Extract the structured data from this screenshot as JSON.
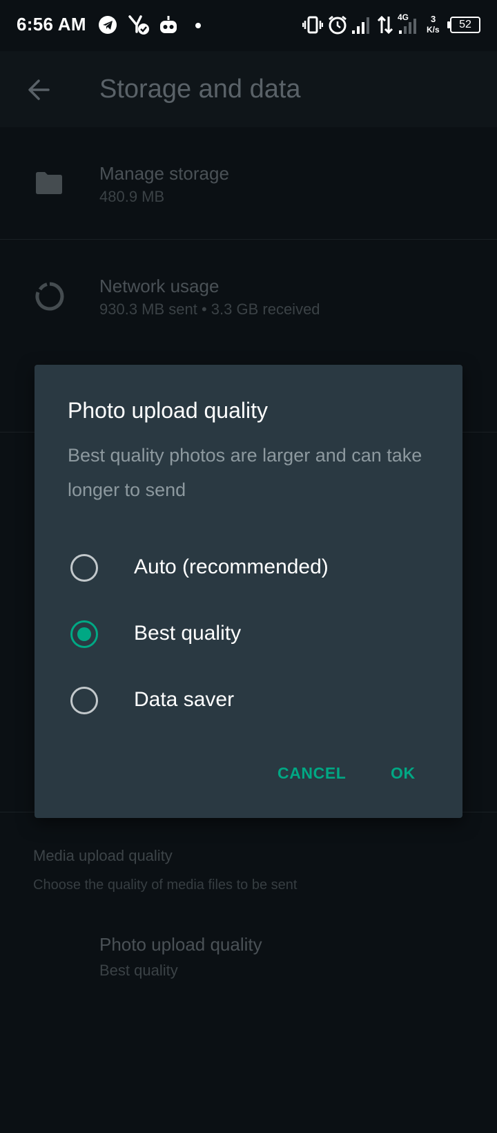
{
  "status_bar": {
    "time": "6:56 AM",
    "network_type": "4G",
    "speed_value": "3",
    "speed_unit": "K/s",
    "battery": "52",
    "icons": [
      "telegram-icon",
      "fork-check-icon",
      "robot-icon",
      "dot-icon",
      "vibrate-icon",
      "alarm-icon",
      "signal-icon",
      "data-arrows-icon",
      "signal-4g-icon",
      "battery-icon"
    ]
  },
  "app_bar": {
    "title": "Storage and data",
    "back_icon": "arrow-left-icon"
  },
  "list": {
    "manage_storage": {
      "title": "Manage storage",
      "subtitle": "480.9 MB",
      "icon": "folder-icon"
    },
    "network_usage": {
      "title": "Network usage",
      "subtitle": "930.3 MB sent • 3.3 GB received",
      "icon": "data-usage-icon"
    },
    "media_section": {
      "title": "Media upload quality",
      "subtitle": "Choose the quality of media files to be sent"
    },
    "photo_upload": {
      "title": "Photo upload quality",
      "subtitle": "Best quality"
    }
  },
  "dialog": {
    "title": "Photo upload quality",
    "message": "Best quality photos are larger and can take longer to send",
    "options": [
      {
        "label": "Auto (recommended)",
        "selected": false
      },
      {
        "label": "Best quality",
        "selected": true
      },
      {
        "label": "Data saver",
        "selected": false
      }
    ],
    "cancel_label": "CANCEL",
    "ok_label": "OK"
  },
  "colors": {
    "accent": "#00a884",
    "dialog_bg": "#2a3942",
    "page_bg": "#0b1014"
  }
}
